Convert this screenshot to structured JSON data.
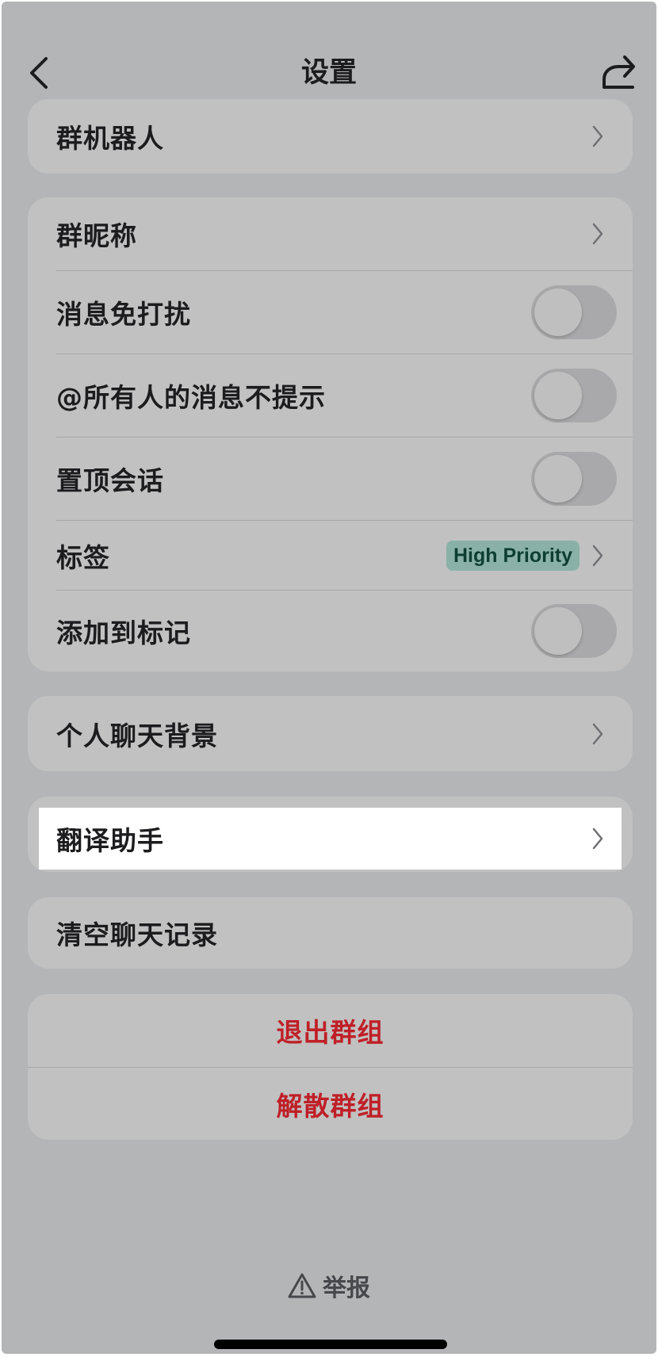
{
  "header": {
    "title": "设置",
    "back_icon": "chevron-left-icon",
    "share_icon": "share-icon"
  },
  "group_bots": {
    "label": "群机器人"
  },
  "group_settings": {
    "nickname_label": "群昵称",
    "mute_label": "消息免打扰",
    "mute_on": false,
    "mention_label": "@所有人的消息不提示",
    "mention_on": false,
    "pin_label": "置顶会话",
    "pin_on": false,
    "tag_label": "标签",
    "tag_value": "High Priority",
    "mark_label": "添加到标记",
    "mark_on": false
  },
  "group_background": {
    "label": "个人聊天背景"
  },
  "group_translate": {
    "label": "翻译助手"
  },
  "group_clear": {
    "label": "清空聊天记录"
  },
  "group_danger": {
    "leave_label": "退出群组",
    "dissolve_label": "解散群组"
  },
  "report": {
    "label": "举报",
    "icon": "warning-triangle-icon"
  },
  "colors": {
    "background": "#b4b5b7",
    "card": "#c1c1c1",
    "danger": "#c01f27",
    "tag_bg": "#89b1a7",
    "tag_text": "#0f3d31"
  }
}
